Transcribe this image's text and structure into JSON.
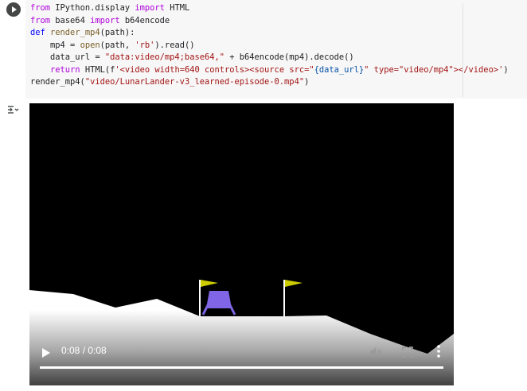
{
  "cell": {
    "code_lines": [
      [
        {
          "t": "from",
          "c": "kw"
        },
        {
          "t": " IPython.display ",
          "c": ""
        },
        {
          "t": "import",
          "c": "kw"
        },
        {
          "t": " HTML",
          "c": ""
        }
      ],
      [
        {
          "t": "from",
          "c": "kw"
        },
        {
          "t": " base64 ",
          "c": ""
        },
        {
          "t": "import",
          "c": "kw"
        },
        {
          "t": " b64encode",
          "c": ""
        }
      ],
      [
        {
          "t": "def",
          "c": "bl"
        },
        {
          "t": " render_mp4",
          "c": "fn"
        },
        {
          "t": "(path):",
          "c": ""
        }
      ],
      [
        {
          "t": "    mp4 = ",
          "c": ""
        },
        {
          "t": "open",
          "c": "fn"
        },
        {
          "t": "(path, ",
          "c": ""
        },
        {
          "t": "'rb'",
          "c": "st"
        },
        {
          "t": ").read()",
          "c": ""
        }
      ],
      [
        {
          "t": "    data_url = ",
          "c": ""
        },
        {
          "t": "\"data:video/mp4;base64,\"",
          "c": "st"
        },
        {
          "t": " + b64encode(mp4).decode()",
          "c": ""
        }
      ],
      [
        {
          "t": "    ",
          "c": ""
        },
        {
          "t": "return",
          "c": "kw"
        },
        {
          "t": " HTML(f",
          "c": ""
        },
        {
          "t": "'<video width=640 controls><source src=\"",
          "c": "st"
        },
        {
          "t": "{data_url}",
          "c": "blue"
        },
        {
          "t": "\" type=\"video/mp4\"></video>'",
          "c": "st"
        },
        {
          "t": ")",
          "c": ""
        }
      ],
      [
        {
          "t": "render_mp4(",
          "c": ""
        },
        {
          "t": "\"video/LunarLander-v3_learned-episode-0.mp4\"",
          "c": "st"
        },
        {
          "t": ")",
          "c": ""
        }
      ]
    ]
  },
  "icons": {
    "run": "play-circle-icon",
    "output_toggle": "output-toggle-icon",
    "play": "play-icon",
    "volume": "volume-muted-icon",
    "fullscreen": "fullscreen-icon",
    "more": "more-vert-icon"
  },
  "video": {
    "time_display": "0:08 / 0:08",
    "progress_fraction": 1.0,
    "colors": {
      "background": "#000000",
      "terrain": "#ffffff",
      "lander": "#8066e6",
      "flag": "#cccc00"
    }
  }
}
